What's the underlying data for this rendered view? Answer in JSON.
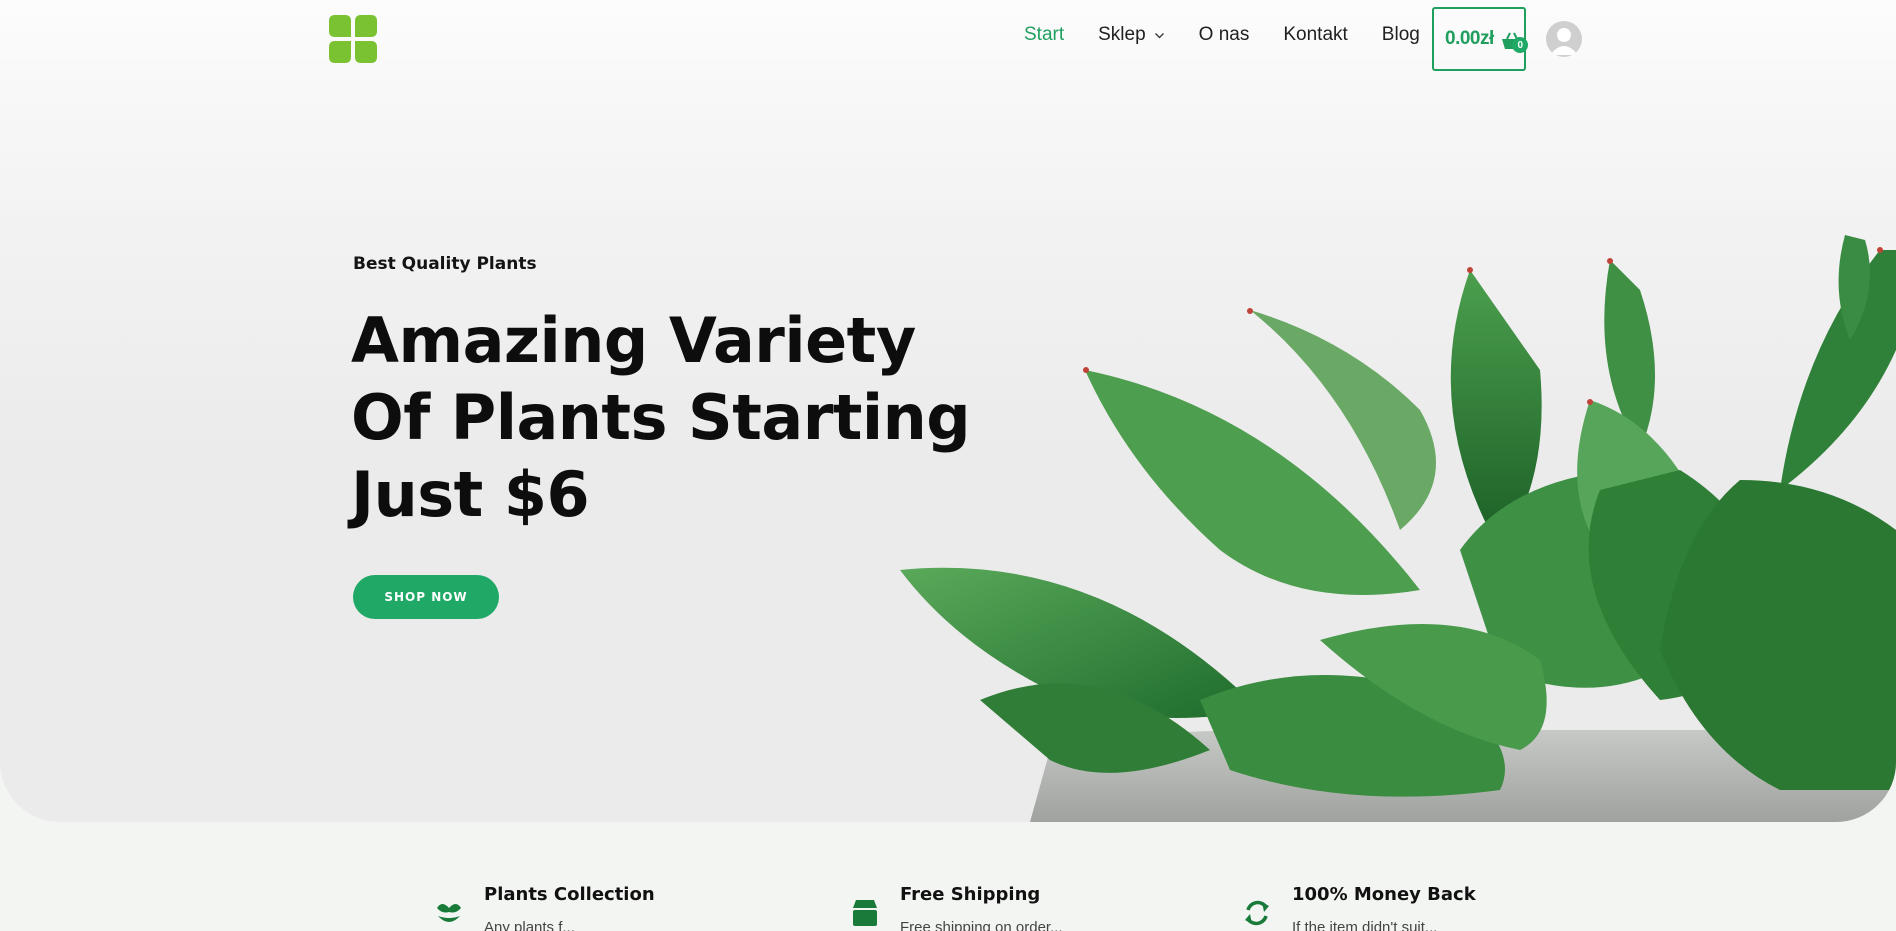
{
  "header": {
    "logo_icon": "four-leaf-logo-icon",
    "nav": [
      {
        "label": "Start",
        "active": true
      },
      {
        "label": "Sklep",
        "has_dropdown": true
      },
      {
        "label": "O nas"
      },
      {
        "label": "Kontakt"
      },
      {
        "label": "Blog"
      }
    ],
    "cart": {
      "total": "0.00zł",
      "count": "0",
      "icon": "basket-icon"
    },
    "avatar_icon": "user-avatar-icon"
  },
  "hero": {
    "eyebrow": "Best Quality Plants",
    "headline_lines": [
      "Amazing Variety",
      "Of Plants Starting",
      "Just $6"
    ],
    "cta_label": "SHOP NOW"
  },
  "features": [
    {
      "title": "Plants Collection",
      "text": "Any plants f...",
      "icon": "sprout-icon"
    },
    {
      "title": "Free Shipping",
      "text": "Free shipping on order...",
      "icon": "box-icon"
    },
    {
      "title": "100% Money Back",
      "text": "If the item didn't suit...",
      "icon": "refresh-icon"
    }
  ],
  "colors": {
    "accent": "#1fa866",
    "logo": "#7ac231",
    "text": "#0d0d0d",
    "feature_icon": "#1a7a3a"
  }
}
